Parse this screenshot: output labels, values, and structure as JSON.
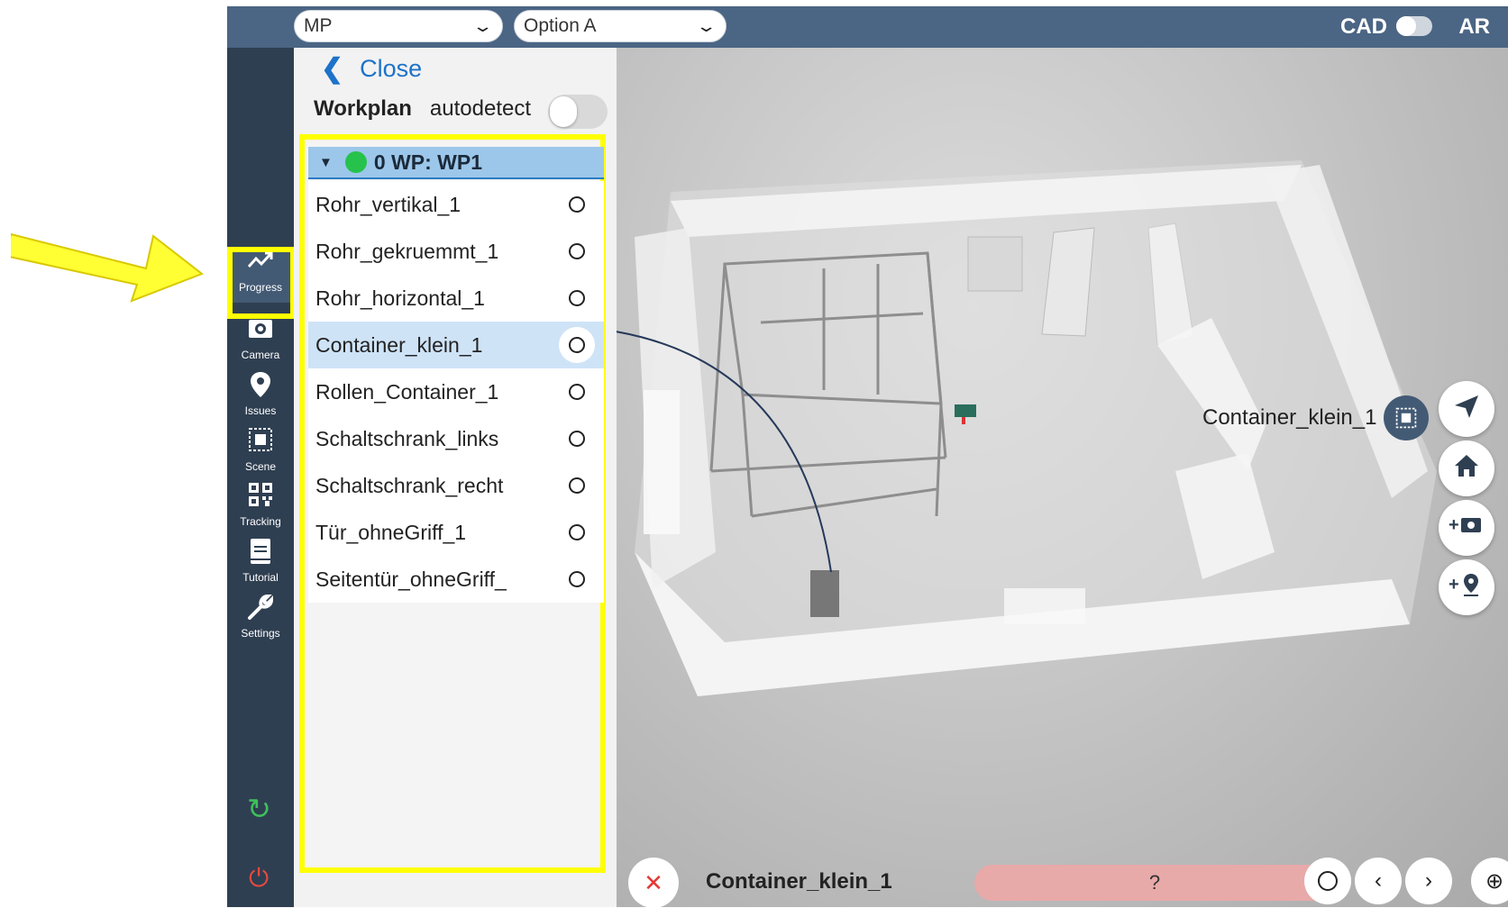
{
  "topbar": {
    "mode_select": "MP",
    "option_select": "Option A",
    "cad_label": "CAD",
    "ar_label": "AR"
  },
  "sidebar": {
    "items": [
      {
        "label": "Progress",
        "icon": "trend-up-icon",
        "glyph": "↗"
      },
      {
        "label": "Camera",
        "icon": "camera-icon",
        "glyph": "◙"
      },
      {
        "label": "Issues",
        "icon": "location-pin-icon",
        "glyph": "⬤"
      },
      {
        "label": "Scene",
        "icon": "scene-icon",
        "glyph": "⬚"
      },
      {
        "label": "Tracking",
        "icon": "qr-code-icon",
        "glyph": "▦"
      },
      {
        "label": "Tutorial",
        "icon": "book-icon",
        "glyph": "▤"
      },
      {
        "label": "Settings",
        "icon": "wrench-icon",
        "glyph": "🔧"
      }
    ],
    "sync_icon": "↻",
    "power_icon": "⏻"
  },
  "panel": {
    "close_label": "Close",
    "workplan_title": "Workplan",
    "autodetect_label": "autodetect",
    "workplan_header": "0 WP: WP1",
    "items": [
      {
        "name": "Rohr_vertikal_1"
      },
      {
        "name": "Rohr_gekruemmt_1"
      },
      {
        "name": "Rohr_horizontal_1"
      },
      {
        "name": "Container_klein_1"
      },
      {
        "name": "Rollen_Container_1"
      },
      {
        "name": "Schaltschrank_links"
      },
      {
        "name": "Schaltschrank_recht"
      },
      {
        "name": "Tür_ohneGriff_1"
      },
      {
        "name": "Seitentür_ohneGriff_"
      }
    ],
    "selected_index": 3
  },
  "viewport": {
    "object_label": "Container_klein_1",
    "buttons": [
      {
        "name": "send-icon",
        "glyph": "➤"
      },
      {
        "name": "home-icon",
        "glyph": "⌂"
      },
      {
        "name": "add-photo-icon",
        "glyph": "+◙"
      },
      {
        "name": "add-marker-icon",
        "glyph": "+⚲"
      }
    ]
  },
  "bottom": {
    "cancel_glyph": "✕",
    "title": "Container_klein_1",
    "status": "?",
    "prev_glyph": "‹",
    "next_glyph": "›",
    "target_glyph": "⊕"
  },
  "colors": {
    "topbar": "#4b6584",
    "sidebar": "#2f3f52",
    "highlight": "#ffff00",
    "accent": "#1d72c9",
    "status_dot": "#27c24b",
    "status_pill": "#e8a9a9"
  }
}
